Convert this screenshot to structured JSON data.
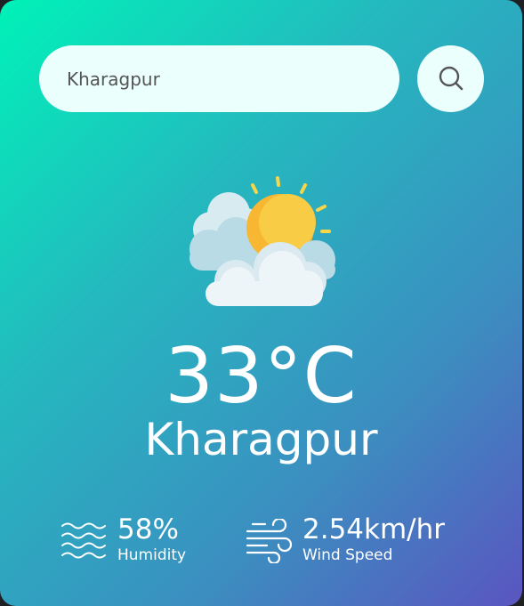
{
  "search": {
    "value": "Kharagpur",
    "icon": "search-icon"
  },
  "weather": {
    "icon": "partly-cloudy-icon",
    "temperature": "33°C",
    "city": "Kharagpur"
  },
  "humidity": {
    "value": "58%",
    "label": "Humidity",
    "icon": "humidity-waves-icon"
  },
  "wind": {
    "value": "2.54km/hr",
    "label": "Wind Speed",
    "icon": "wind-icon"
  },
  "colors": {
    "gradient_start": "#00f2b8",
    "gradient_end": "#5a55c0",
    "field_bg": "#ebfffc",
    "text": "#ffffff"
  }
}
